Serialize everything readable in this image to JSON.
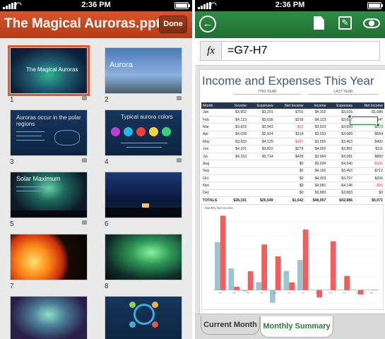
{
  "status": {
    "time": "2:36 PM"
  },
  "presentation": {
    "title": "The Magical Auroras.pptx",
    "done_label": "Done",
    "slides": [
      {
        "number": "1",
        "title": "The Magical Auroras"
      },
      {
        "number": "2",
        "title": "Aurora"
      },
      {
        "number": "3",
        "title": "Auroras occur in the polar regions"
      },
      {
        "number": "4",
        "title": "Typical aurora colors"
      },
      {
        "number": "5",
        "title": "Solar Maximum"
      },
      {
        "number": "6",
        "title": ""
      },
      {
        "number": "7",
        "title": ""
      },
      {
        "number": "8",
        "title": ""
      }
    ]
  },
  "spreadsheet": {
    "formula_icon": "fx",
    "formula": "=G7-H7",
    "title": "Income and Expenses This Year",
    "this_year": "THIS YEAR",
    "last_year": "LAST YEAR",
    "headers": [
      "Month",
      "Income",
      "Expenses",
      "Net Income",
      "Income",
      "Expenses",
      "Net Income"
    ],
    "rows": [
      [
        "Jan",
        "$3,902",
        "$3,201",
        "$701",
        "$4,102",
        "$3,016",
        "$1,086"
      ],
      [
        "Feb",
        "$4,123",
        "$3,639",
        "$316",
        "$4,123",
        "$3,657",
        "$47"
      ],
      [
        "Mar",
        "$3,923",
        "$3,943",
        "-$20",
        "$3,923",
        "$3,650",
        "$273"
      ],
      [
        "Apr",
        "$4,028",
        "$3,914",
        "$114",
        "$3,933",
        "$3,689",
        "$664"
      ],
      [
        "May",
        "$3,933",
        "$4,120",
        "-$187",
        "$3,955",
        "$3,463",
        "$492"
      ],
      [
        "Jun",
        "$4,101",
        "$3,822",
        "$279",
        "$4,002",
        "$3,891",
        "$111"
      ],
      [
        "Jul",
        "$4,153",
        "$3,714",
        "$439",
        "$3,964",
        "$3,081",
        "$883"
      ],
      [
        "Aug",
        "",
        "",
        "$0",
        "$3,934",
        "$4,040",
        "-$106"
      ],
      [
        "Sep",
        "",
        "",
        "$0",
        "$4,165",
        "$3,453",
        "$712"
      ],
      [
        "Oct",
        "",
        "",
        "$0",
        "$4,003",
        "$3,797",
        "$206"
      ],
      [
        "Nov",
        "",
        "",
        "$0",
        "$4,081",
        "$4,146",
        "-$65"
      ],
      [
        "Dec",
        "",
        "",
        "$0",
        "$3,883",
        "$3,883",
        "$0"
      ]
    ],
    "totals": [
      "TOTALS",
      "$28,191",
      "$26,549",
      "$1,642",
      "$48,057",
      "$42,986",
      "$5,071"
    ],
    "chart_title": "Monthly Net Income",
    "tabs": {
      "current": "Current Month",
      "monthly": "Monthly Summary"
    }
  },
  "chart_data": {
    "type": "bar",
    "title": "Monthly Net Income",
    "categories": [
      "Jan",
      "Feb",
      "Mar",
      "Apr",
      "May",
      "Jun",
      "Jul",
      "Aug",
      "Sep",
      "Oct",
      "Nov",
      "Dec"
    ],
    "series": [
      {
        "values": [
          701,
          316,
          -20,
          114,
          -187,
          279,
          439,
          0,
          0,
          0,
          0,
          0
        ],
        "color": "#9ec4cd"
      },
      {
        "values": [
          1086,
          47,
          273,
          664,
          492,
          111,
          883,
          -106,
          712,
          206,
          -65,
          0
        ],
        "color": "#f25d5d"
      }
    ],
    "ylim": [
      -200,
      1100
    ],
    "grid": true
  }
}
